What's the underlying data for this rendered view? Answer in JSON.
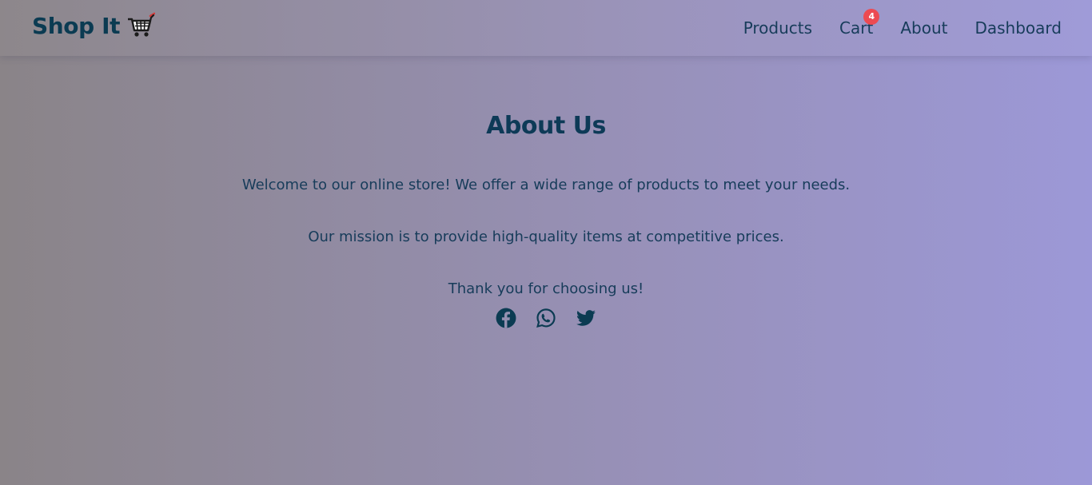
{
  "navbar": {
    "brand": "Shop It",
    "brand_icon": "shopping-cart-icon",
    "links": [
      {
        "label": "Products"
      },
      {
        "label": "Cart",
        "badge": "4"
      },
      {
        "label": "About"
      },
      {
        "label": "Dashboard"
      }
    ]
  },
  "about": {
    "title": "About Us",
    "paragraphs": [
      "Welcome to our online store! We offer a wide range of products to meet your needs.",
      "Our mission is to provide high-quality items at competitive prices.",
      "Thank you for choosing us!"
    ],
    "socials": [
      "facebook-icon",
      "whatsapp-icon",
      "twitter-icon"
    ]
  },
  "colors": {
    "primary_text": "#0b3b52",
    "badge": "#ec4a52",
    "background_left": "#8a8488",
    "background_right": "#9c98d7"
  }
}
